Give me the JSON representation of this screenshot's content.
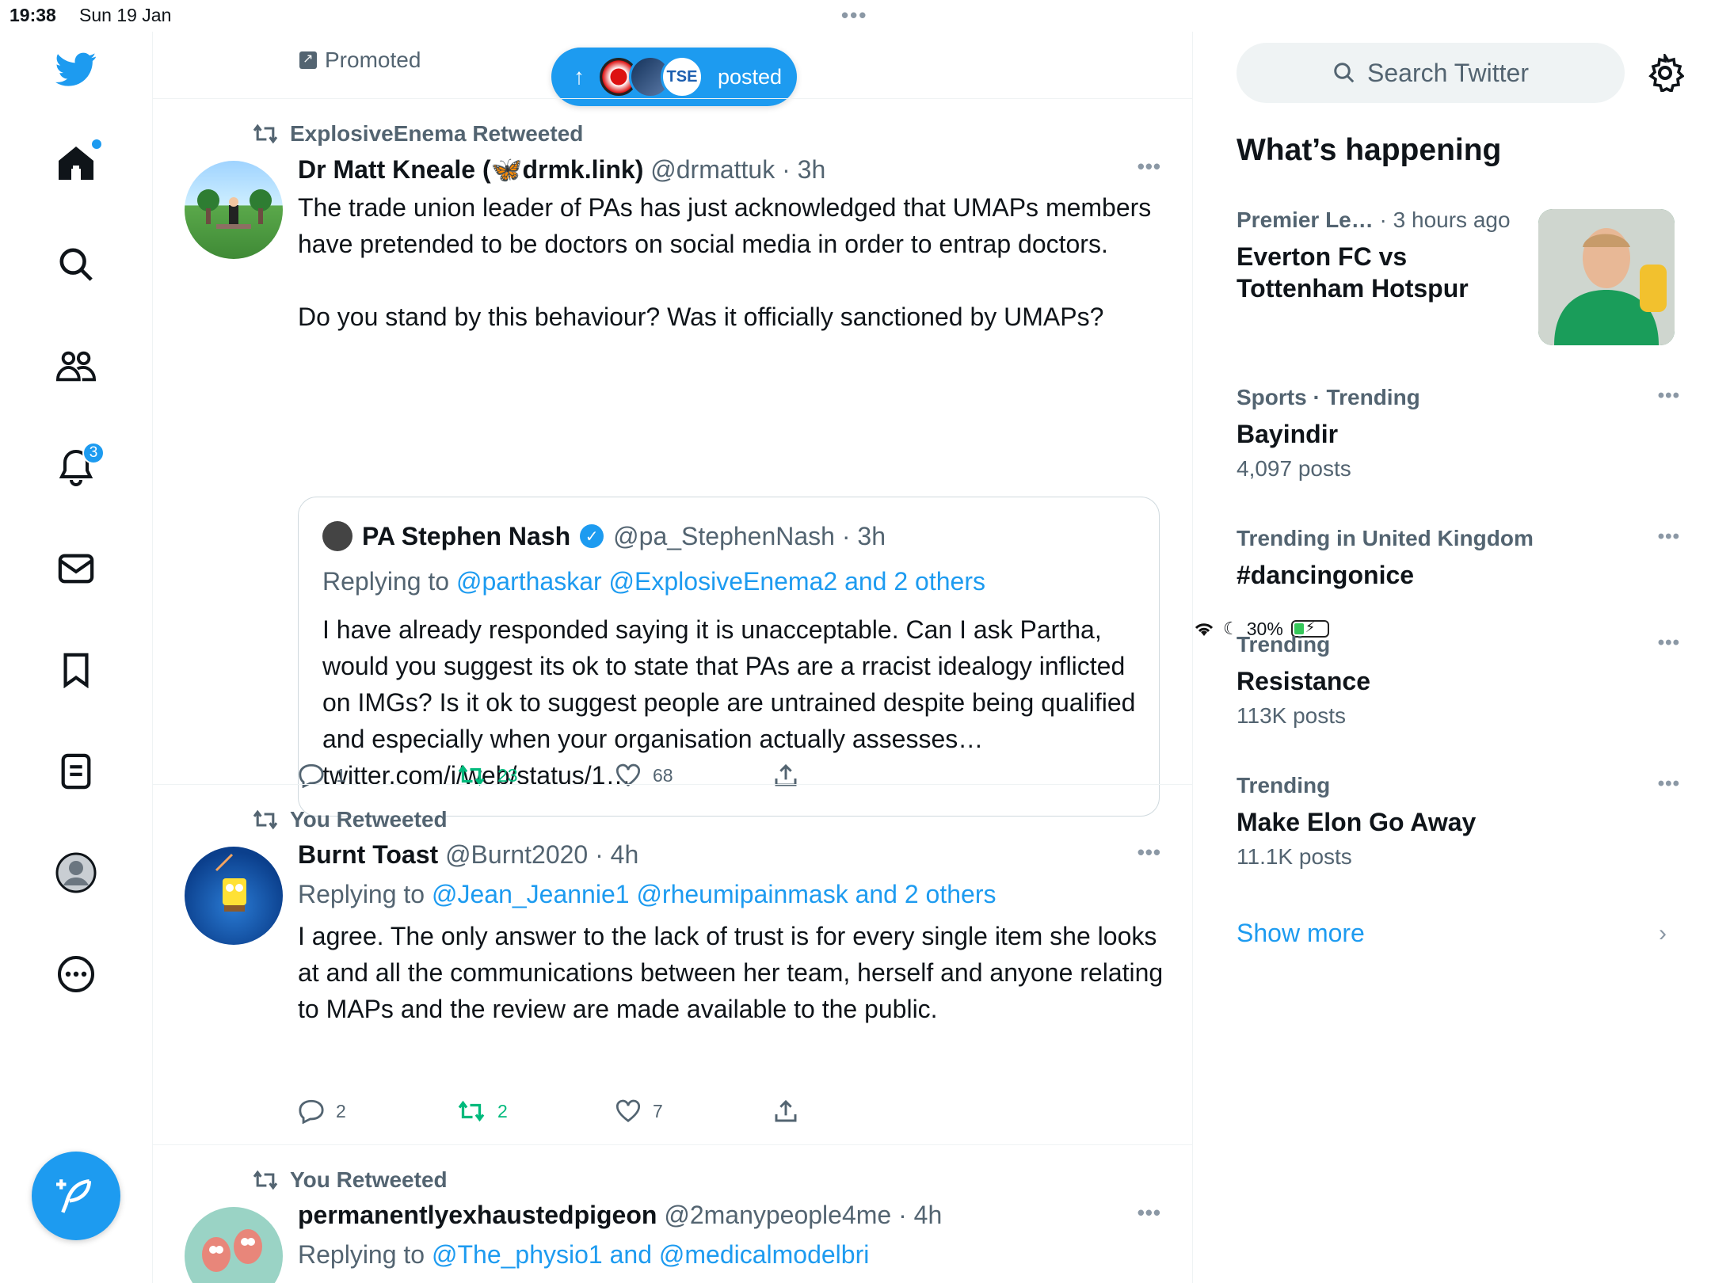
{
  "status": {
    "time": "19:38",
    "date": "Sun 19 Jan",
    "battery": "30%"
  },
  "nav": {
    "notifications_badge": "3"
  },
  "timeline": {
    "promoted_label": "Promoted",
    "posted_pill_label": "posted",
    "tweets": [
      {
        "retweeted_by": "ExplosiveEnema Retweeted",
        "name": "Dr Matt Kneale (🦋drmk.link)",
        "handle": "@drmattuk",
        "time": "3h",
        "body": [
          "The trade union leader of PAs has just acknowledged that UMAPs members have pretended to be doctors on social media in order to entrap doctors.",
          "Do you stand by this behaviour? Was it officially sanctioned by UMAPs?"
        ],
        "quote": {
          "name": "PA Stephen Nash",
          "handle": "@pa_StephenNash",
          "time": "3h",
          "replying_prefix": "Replying to",
          "replying_to": "@parthaskar @ExplosiveEnema2 and 2 others",
          "body": "I have already responded saying it is unacceptable. Can I ask Partha, would you suggest its ok to state that PAs are a rracist idealogy inflicted on IMGs? Is it ok to suggest people are untrained despite being qualified and especially when your organisation actually assesses… twitter.com/i/web/status/1…"
        },
        "replies": "1",
        "retweets": "23",
        "likes": "68"
      },
      {
        "retweeted_by": "You Retweeted",
        "name": "Burnt Toast",
        "handle": "@Burnt2020",
        "time": "4h",
        "replying_prefix": "Replying to",
        "replying_to": "@Jean_Jeannie1 @rheumipainmask and 2 others",
        "body": "I agree. The only answer to the lack of trust is for every single item she looks at and all the communications between her team, herself and anyone relating to MAPs and the review are made available to the public.",
        "replies": "2",
        "retweets": "2",
        "likes": "7"
      },
      {
        "retweeted_by": "You Retweeted",
        "name": "permanentlyexhaustedpigeon",
        "handle": "@2manypeople4me",
        "time": "4h",
        "replying_prefix": "Replying to",
        "replying_to": "@The_physio1 and @medicalmodelbri"
      }
    ]
  },
  "sidebar": {
    "search_placeholder": "Search Twitter",
    "whats_happening": "What’s happening",
    "trends": [
      {
        "category": "Premier Le…",
        "when": "3 hours ago",
        "title": "Everton FC vs Tottenham Hotspur",
        "count": ""
      },
      {
        "category": "Sports · Trending",
        "when": "",
        "title": "Bayindir",
        "count": "4,097 posts"
      },
      {
        "category": "Trending in United Kingdom",
        "when": "",
        "title": "#dancingonice",
        "count": ""
      },
      {
        "category": "Trending",
        "when": "",
        "title": "Resistance",
        "count": "113K posts"
      },
      {
        "category": "Trending",
        "when": "",
        "title": "Make Elon Go Away",
        "count": "11.1K posts"
      }
    ],
    "show_more": "Show more"
  },
  "colors": {
    "accent": "#1d9bf0",
    "retweet_green": "#00ba7c",
    "secondary_text": "#536471"
  }
}
